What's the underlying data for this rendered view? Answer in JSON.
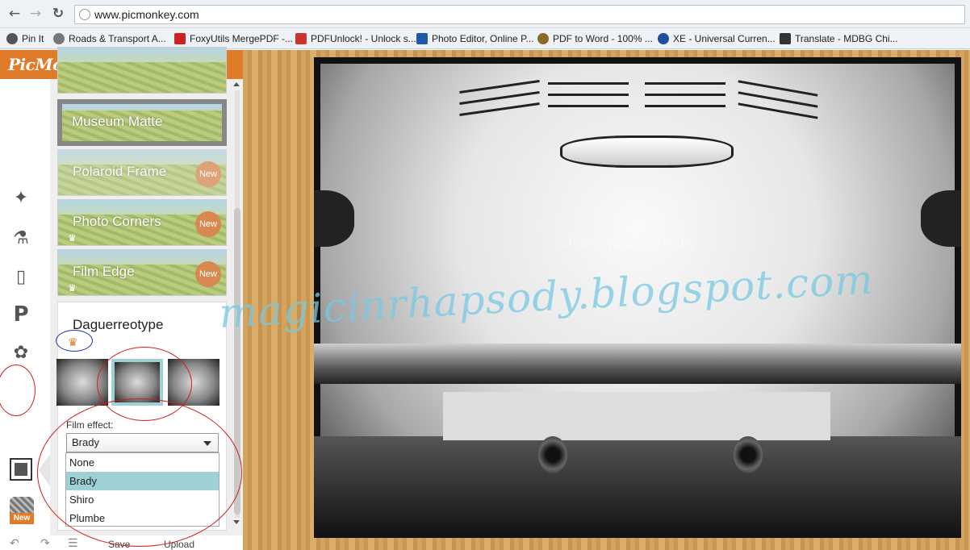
{
  "browser": {
    "url": "www.picmonkey.com",
    "bookmarks": [
      {
        "label": "Pin It",
        "icon": "pin-it-icon",
        "color": "#555555"
      },
      {
        "label": "Roads & Transport A...",
        "icon": "globe-icon",
        "color": "#777777"
      },
      {
        "label": "FoxyUtils MergePDF -...",
        "icon": "foxyutils-icon",
        "color": "#cc2222"
      },
      {
        "label": "PDFUnlock! - Unlock s...",
        "icon": "pdf-icon",
        "color": "#cc3333"
      },
      {
        "label": "Photo Editor, Online P...",
        "icon": "photo-editor-icon",
        "color": "#1f5aa8"
      },
      {
        "label": "PDF to Word - 100% ...",
        "icon": "pdf-word-icon",
        "color": "#8a6a2a"
      },
      {
        "label": "XE - Universal Curren...",
        "icon": "xe-icon",
        "color": "#1f4fa0"
      },
      {
        "label": "Translate - MDBG Chi...",
        "icon": "mdbg-icon",
        "color": "#333333"
      }
    ]
  },
  "app": {
    "logo": "PicMonkey",
    "frames": [
      {
        "label": "Museum Matte",
        "new": ""
      },
      {
        "label": "Polaroid Frame",
        "new": "New"
      },
      {
        "label": "Photo Corners",
        "new": "New"
      },
      {
        "label": "Film Edge",
        "new": "New"
      }
    ],
    "new_tag": "New",
    "active_frame": {
      "title": "Daguerreotype",
      "film_label": "Film effect:",
      "selected": "Brady",
      "options": [
        "None",
        "Brady",
        "Shiro",
        "Plumbe"
      ]
    },
    "bottom": {
      "save": "Save",
      "upload": "Upload"
    }
  },
  "canvas": {
    "photo_credit": "cfisherphotography",
    "watermark": "magicinrhapsody.blogspot.com"
  },
  "annotation_color": "#d21f1f",
  "accent": "#e07b2a"
}
